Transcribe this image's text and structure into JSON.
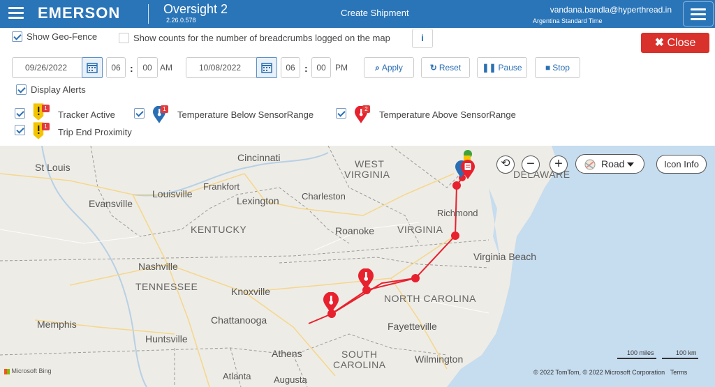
{
  "header": {
    "brand": "EMERSON",
    "app_title": "Oversight 2",
    "app_version": "2.26.0.578",
    "create_shipment": "Create Shipment",
    "user_email": "vandana.bandla@hyperthread.in",
    "timezone": "Argentina Standard Time"
  },
  "controls": {
    "show_geofence": "Show Geo-Fence",
    "show_counts": "Show counts for the number of breadcrumbs logged on the map",
    "info": "i",
    "close": "Close",
    "start_date": "09/26/2022",
    "start_hour": "06",
    "start_min": "00",
    "start_ampm": "AM",
    "end_date": "10/08/2022",
    "end_hour": "06",
    "end_min": "00",
    "end_ampm": "PM",
    "apply": "Apply",
    "reset": "Reset",
    "pause": "Pause",
    "stop": "Stop",
    "display_alerts": "Display Alerts"
  },
  "alerts": [
    {
      "label": "Tracker Active",
      "count": "1"
    },
    {
      "label": "Temperature Below SensorRange",
      "count": "1"
    },
    {
      "label": "Temperature Above SensorRange",
      "count": "2"
    },
    {
      "label": "Trip End Proximity",
      "count": "1"
    }
  ],
  "map": {
    "road_label": "Road",
    "icon_info": "Icon Info",
    "scale_miles": "100 miles",
    "scale_km": "100 km",
    "copyright": "© 2022 TomTom, © 2022 Microsoft Corporation",
    "terms": "Terms",
    "bing": "Microsoft Bing",
    "labels": {
      "st_louis": "St Louis",
      "cincinnati": "Cincinnati",
      "west_virginia_1": "WEST",
      "west_virginia_2": "VIRGINIA",
      "delaware": "DELAWARE",
      "louisville": "Louisville",
      "frankfort": "Frankfort",
      "evansville": "Evansville",
      "lexington": "Lexington",
      "charleston": "Charleston",
      "richmond": "Richmond",
      "kentucky": "KENTUCKY",
      "roanoke": "Roanoke",
      "virginia": "VIRGINIA",
      "virginia_beach": "Virginia Beach",
      "nashville": "Nashville",
      "tennessee": "TENNESSEE",
      "knoxville": "Knoxville",
      "north_carolina": "NORTH CAROLINA",
      "memphis": "Memphis",
      "chattanooga": "Chattanooga",
      "fayetteville": "Fayetteville",
      "huntsville": "Huntsville",
      "athens": "Athens",
      "south_carolina_1": "SOUTH",
      "south_carolina_2": "CAROLINA",
      "wilmington": "Wilmington",
      "atlanta": "Atlanta",
      "augusta": "Augusta"
    }
  },
  "colors": {
    "header": "#2a75b8",
    "close": "#d9312b",
    "route": "#e8212e",
    "alert_yellow": "#f5c400",
    "alert_blue": "#2a6fb4"
  }
}
